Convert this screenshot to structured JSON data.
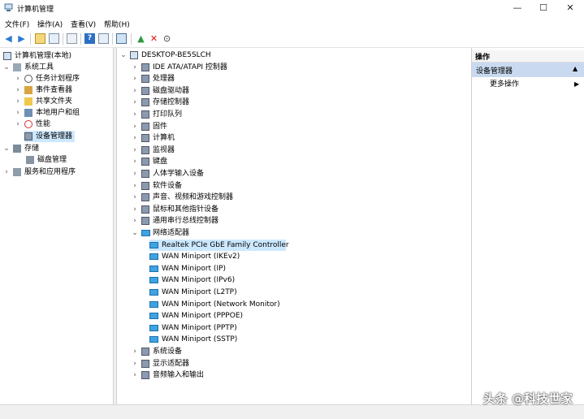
{
  "window": {
    "title": "计算机管理",
    "minimize": "—",
    "maximize": "☐",
    "close": "✕"
  },
  "menu": [
    "文件(F)",
    "操作(A)",
    "查看(V)",
    "帮助(H)"
  ],
  "left_tree": {
    "root": "计算机管理(本地)",
    "system_tools": "系统工具",
    "task_scheduler": "任务计划程序",
    "event_viewer": "事件查看器",
    "shared_folders": "共享文件夹",
    "local_users": "本地用户和组",
    "performance": "性能",
    "device_manager": "设备管理器",
    "storage": "存储",
    "disk_management": "磁盘管理",
    "services_apps": "服务和应用程序"
  },
  "device_tree": {
    "computer": "DESKTOP-BE5SLCH",
    "categories_top": [
      "IDE ATA/ATAPI 控制器",
      "处理器",
      "磁盘驱动器",
      "存储控制器",
      "打印队列",
      "固件",
      "计算机",
      "监视器",
      "键盘",
      "人体学输入设备",
      "软件设备",
      "声音、视频和游戏控制器",
      "鼠标和其他指针设备",
      "通用串行总线控制器"
    ],
    "network_adapters": "网络适配器",
    "adapters": [
      "Realtek PCIe GbE Family Controller",
      "WAN Miniport (IKEv2)",
      "WAN Miniport (IP)",
      "WAN Miniport (IPv6)",
      "WAN Miniport (L2TP)",
      "WAN Miniport (Network Monitor)",
      "WAN Miniport (PPPOE)",
      "WAN Miniport (PPTP)",
      "WAN Miniport (SSTP)"
    ],
    "categories_bottom": [
      "系统设备",
      "显示适配器",
      "音频输入和输出"
    ]
  },
  "actions": {
    "header": "操作",
    "section": "设备管理器",
    "more": "更多操作"
  },
  "watermark": "头条 @科技世家"
}
